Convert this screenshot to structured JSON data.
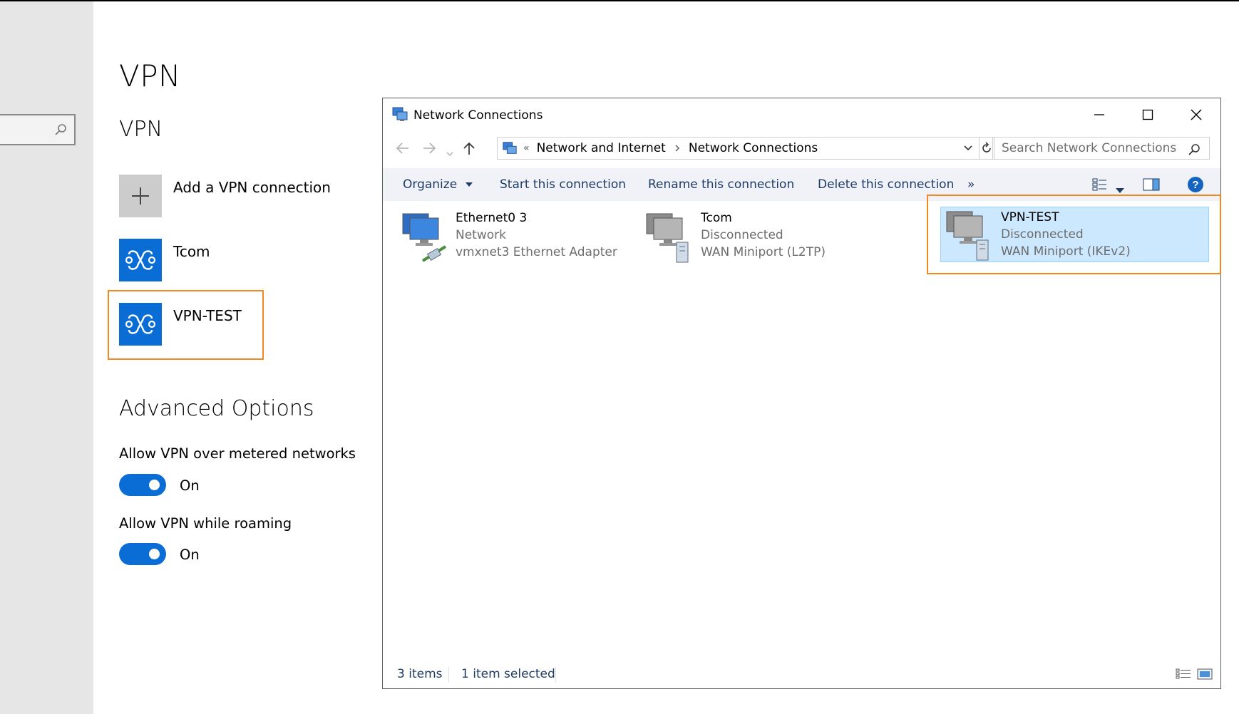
{
  "settings": {
    "page_title": "VPN",
    "section_title": "VPN",
    "add_label": "Add a VPN connection",
    "vpn_items": [
      {
        "label": "Tcom"
      },
      {
        "label": "VPN-TEST"
      }
    ],
    "advanced_title": "Advanced Options",
    "options": [
      {
        "label": "Allow VPN over metered networks",
        "state": "On"
      },
      {
        "label": "Allow VPN while roaming",
        "state": "On"
      }
    ]
  },
  "window": {
    "title": "Network Connections",
    "address": {
      "overflow": "«",
      "crumbs": [
        "Network and Internet",
        "Network Connections"
      ]
    },
    "search_placeholder": "Search Network Connections",
    "commands": {
      "organize": "Organize",
      "start": "Start this connection",
      "rename": "Rename this connection",
      "delete": "Delete this connection",
      "more": "»"
    },
    "connections": [
      {
        "name": "Ethernet0 3",
        "line2": "Network",
        "line3": "vmxnet3 Ethernet Adapter"
      },
      {
        "name": "Tcom",
        "line2": "Disconnected",
        "line3": "WAN Miniport (L2TP)"
      },
      {
        "name": "VPN-TEST",
        "line2": "Disconnected",
        "line3": "WAN Miniport (IKEv2)"
      }
    ],
    "status": {
      "count": "3 items",
      "selected": "1 item selected"
    }
  },
  "colors": {
    "accent": "#0a6dd6",
    "highlight": "#f08a1f",
    "selection": "#cce8ff"
  }
}
